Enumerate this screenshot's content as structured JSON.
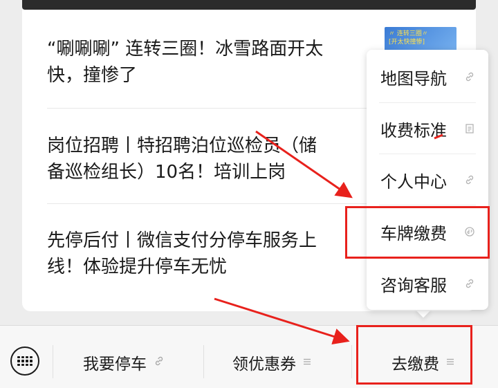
{
  "articles": [
    {
      "line1": "“唰唰唰” 连转三圈！冰雪路面开太",
      "line2": "快，撞惨了"
    },
    {
      "line1": "岗位招聘丨特招聘泊位巡检员（储",
      "line2": "备巡检组长）10名！培训上岗"
    },
    {
      "line1": "先停后付丨微信支付分停车服务上",
      "line2": "线！体验提升停车无忧"
    }
  ],
  "thumbnail": {
    "line1": "〃 连转三圈〃",
    "line2": "[开太快撞惨]"
  },
  "popup_menu": {
    "items": [
      {
        "label": "地图导航",
        "icon": "link-icon"
      },
      {
        "label": "收费标准",
        "icon": "page-icon"
      },
      {
        "label": "个人中心",
        "icon": "link-icon"
      },
      {
        "label": "车牌缴费",
        "icon": "mini-program-icon"
      },
      {
        "label": "咨询客服",
        "icon": "link-icon"
      }
    ]
  },
  "bottom_bar": {
    "tabs": [
      {
        "label": "我要停车",
        "icon": "link-icon"
      },
      {
        "label": "领优惠券",
        "icon": "menu-icon"
      },
      {
        "label": "去缴费",
        "icon": "menu-icon"
      }
    ]
  },
  "colors": {
    "annotation": "#e8211c",
    "background": "#ededed"
  }
}
